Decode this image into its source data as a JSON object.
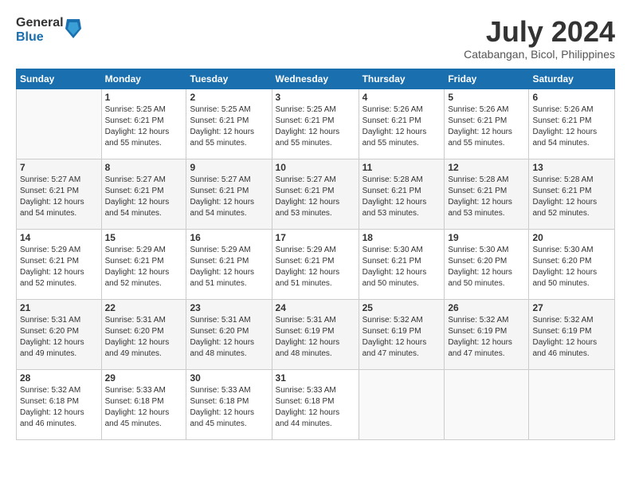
{
  "logo": {
    "general": "General",
    "blue": "Blue"
  },
  "title": {
    "month_year": "July 2024",
    "location": "Catabangan, Bicol, Philippines"
  },
  "headers": [
    "Sunday",
    "Monday",
    "Tuesday",
    "Wednesday",
    "Thursday",
    "Friday",
    "Saturday"
  ],
  "weeks": [
    [
      {
        "day": "",
        "sunrise": "",
        "sunset": "",
        "daylight": ""
      },
      {
        "day": "1",
        "sunrise": "Sunrise: 5:25 AM",
        "sunset": "Sunset: 6:21 PM",
        "daylight": "Daylight: 12 hours and 55 minutes."
      },
      {
        "day": "2",
        "sunrise": "Sunrise: 5:25 AM",
        "sunset": "Sunset: 6:21 PM",
        "daylight": "Daylight: 12 hours and 55 minutes."
      },
      {
        "day": "3",
        "sunrise": "Sunrise: 5:25 AM",
        "sunset": "Sunset: 6:21 PM",
        "daylight": "Daylight: 12 hours and 55 minutes."
      },
      {
        "day": "4",
        "sunrise": "Sunrise: 5:26 AM",
        "sunset": "Sunset: 6:21 PM",
        "daylight": "Daylight: 12 hours and 55 minutes."
      },
      {
        "day": "5",
        "sunrise": "Sunrise: 5:26 AM",
        "sunset": "Sunset: 6:21 PM",
        "daylight": "Daylight: 12 hours and 55 minutes."
      },
      {
        "day": "6",
        "sunrise": "Sunrise: 5:26 AM",
        "sunset": "Sunset: 6:21 PM",
        "daylight": "Daylight: 12 hours and 54 minutes."
      }
    ],
    [
      {
        "day": "7",
        "sunrise": "Sunrise: 5:27 AM",
        "sunset": "Sunset: 6:21 PM",
        "daylight": "Daylight: 12 hours and 54 minutes."
      },
      {
        "day": "8",
        "sunrise": "Sunrise: 5:27 AM",
        "sunset": "Sunset: 6:21 PM",
        "daylight": "Daylight: 12 hours and 54 minutes."
      },
      {
        "day": "9",
        "sunrise": "Sunrise: 5:27 AM",
        "sunset": "Sunset: 6:21 PM",
        "daylight": "Daylight: 12 hours and 54 minutes."
      },
      {
        "day": "10",
        "sunrise": "Sunrise: 5:27 AM",
        "sunset": "Sunset: 6:21 PM",
        "daylight": "Daylight: 12 hours and 53 minutes."
      },
      {
        "day": "11",
        "sunrise": "Sunrise: 5:28 AM",
        "sunset": "Sunset: 6:21 PM",
        "daylight": "Daylight: 12 hours and 53 minutes."
      },
      {
        "day": "12",
        "sunrise": "Sunrise: 5:28 AM",
        "sunset": "Sunset: 6:21 PM",
        "daylight": "Daylight: 12 hours and 53 minutes."
      },
      {
        "day": "13",
        "sunrise": "Sunrise: 5:28 AM",
        "sunset": "Sunset: 6:21 PM",
        "daylight": "Daylight: 12 hours and 52 minutes."
      }
    ],
    [
      {
        "day": "14",
        "sunrise": "Sunrise: 5:29 AM",
        "sunset": "Sunset: 6:21 PM",
        "daylight": "Daylight: 12 hours and 52 minutes."
      },
      {
        "day": "15",
        "sunrise": "Sunrise: 5:29 AM",
        "sunset": "Sunset: 6:21 PM",
        "daylight": "Daylight: 12 hours and 52 minutes."
      },
      {
        "day": "16",
        "sunrise": "Sunrise: 5:29 AM",
        "sunset": "Sunset: 6:21 PM",
        "daylight": "Daylight: 12 hours and 51 minutes."
      },
      {
        "day": "17",
        "sunrise": "Sunrise: 5:29 AM",
        "sunset": "Sunset: 6:21 PM",
        "daylight": "Daylight: 12 hours and 51 minutes."
      },
      {
        "day": "18",
        "sunrise": "Sunrise: 5:30 AM",
        "sunset": "Sunset: 6:21 PM",
        "daylight": "Daylight: 12 hours and 50 minutes."
      },
      {
        "day": "19",
        "sunrise": "Sunrise: 5:30 AM",
        "sunset": "Sunset: 6:20 PM",
        "daylight": "Daylight: 12 hours and 50 minutes."
      },
      {
        "day": "20",
        "sunrise": "Sunrise: 5:30 AM",
        "sunset": "Sunset: 6:20 PM",
        "daylight": "Daylight: 12 hours and 50 minutes."
      }
    ],
    [
      {
        "day": "21",
        "sunrise": "Sunrise: 5:31 AM",
        "sunset": "Sunset: 6:20 PM",
        "daylight": "Daylight: 12 hours and 49 minutes."
      },
      {
        "day": "22",
        "sunrise": "Sunrise: 5:31 AM",
        "sunset": "Sunset: 6:20 PM",
        "daylight": "Daylight: 12 hours and 49 minutes."
      },
      {
        "day": "23",
        "sunrise": "Sunrise: 5:31 AM",
        "sunset": "Sunset: 6:20 PM",
        "daylight": "Daylight: 12 hours and 48 minutes."
      },
      {
        "day": "24",
        "sunrise": "Sunrise: 5:31 AM",
        "sunset": "Sunset: 6:19 PM",
        "daylight": "Daylight: 12 hours and 48 minutes."
      },
      {
        "day": "25",
        "sunrise": "Sunrise: 5:32 AM",
        "sunset": "Sunset: 6:19 PM",
        "daylight": "Daylight: 12 hours and 47 minutes."
      },
      {
        "day": "26",
        "sunrise": "Sunrise: 5:32 AM",
        "sunset": "Sunset: 6:19 PM",
        "daylight": "Daylight: 12 hours and 47 minutes."
      },
      {
        "day": "27",
        "sunrise": "Sunrise: 5:32 AM",
        "sunset": "Sunset: 6:19 PM",
        "daylight": "Daylight: 12 hours and 46 minutes."
      }
    ],
    [
      {
        "day": "28",
        "sunrise": "Sunrise: 5:32 AM",
        "sunset": "Sunset: 6:18 PM",
        "daylight": "Daylight: 12 hours and 46 minutes."
      },
      {
        "day": "29",
        "sunrise": "Sunrise: 5:33 AM",
        "sunset": "Sunset: 6:18 PM",
        "daylight": "Daylight: 12 hours and 45 minutes."
      },
      {
        "day": "30",
        "sunrise": "Sunrise: 5:33 AM",
        "sunset": "Sunset: 6:18 PM",
        "daylight": "Daylight: 12 hours and 45 minutes."
      },
      {
        "day": "31",
        "sunrise": "Sunrise: 5:33 AM",
        "sunset": "Sunset: 6:18 PM",
        "daylight": "Daylight: 12 hours and 44 minutes."
      },
      {
        "day": "",
        "sunrise": "",
        "sunset": "",
        "daylight": ""
      },
      {
        "day": "",
        "sunrise": "",
        "sunset": "",
        "daylight": ""
      },
      {
        "day": "",
        "sunrise": "",
        "sunset": "",
        "daylight": ""
      }
    ]
  ]
}
